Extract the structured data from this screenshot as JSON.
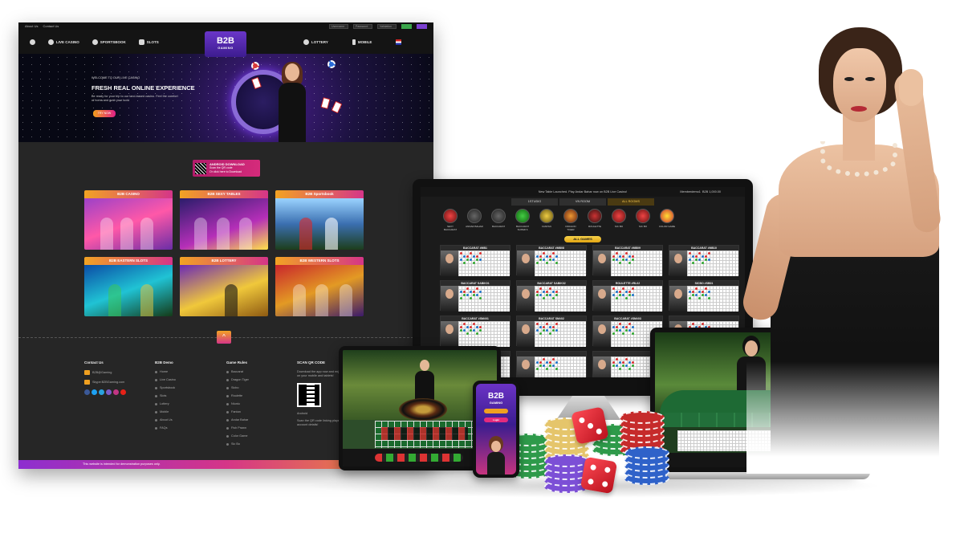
{
  "site": {
    "topstrip": {
      "about": "About Us",
      "contact": "Contact Us",
      "username_ph": "Username",
      "password_ph": "Password",
      "validation_ph": "Validation"
    },
    "nav": {
      "live_casino": "LIVE CASINO",
      "sportsbook": "SPORTSBOOK",
      "slots": "SLOTS",
      "lottery": "LOTTERY",
      "mobile": "MOBILE",
      "new_badge": "NEW"
    },
    "logo": {
      "main": "B2B",
      "sub": "GAMING"
    },
    "hero": {
      "kicker": "WELCOME TO OUR LIVE CASINO",
      "title": "FRESH REAL ONLINE EXPERIENCE",
      "desc": "Be ready for your trip to our land-based casino. Feel the comfort of home and grab your luck!",
      "cta": "TRY NOW"
    },
    "android": {
      "title": "ANDROID DOWNLOAD",
      "line1": "Scan the QR code",
      "line2": "Or click here to Download"
    },
    "tiles": [
      {
        "label": "B2B CASINO"
      },
      {
        "label": "B2B SEXY TABLES"
      },
      {
        "label": "B2B Sportsbook"
      },
      {
        "label": "B2B EASTERN SLOTS"
      },
      {
        "label": "B2B LOTTERY"
      },
      {
        "label": "B2B WESTERN SLOTS"
      }
    ],
    "footer": {
      "contact_title": "Contact Us",
      "contact_email": "B2B@Gaming",
      "contact_skype": "Skype:B2BGaming.com",
      "b2b_title": "B2B Demo",
      "b2b_links": [
        "Home",
        "Live Casino",
        "Sportsbook",
        "Slots",
        "Lottery",
        "Mobile",
        "About Us",
        "FAQs"
      ],
      "rules_title": "Game Rules",
      "rules_links": [
        "Baccarat",
        "Dragon Tiger",
        "Sicbo",
        "Roulette",
        "Niuniu",
        "Fantan",
        "Andar Bahar",
        "Fish Prawn",
        "Color Game",
        "Sic Bo"
      ],
      "qr_title": "SCAN QR CODE",
      "qr_text": "Download the app now and enjoy your Casino across on your mobile and tablets!",
      "qr_text2": "Scan the QR code linking players with their existing account details!",
      "android": "Android",
      "bar": "This website is intended for demonstration purposes only."
    }
  },
  "monitor": {
    "marquee": "New Table Launched. Play Andar Bahar now on B2B Live Casino!",
    "member": "Memberdemo1",
    "balance": "B2B 1,000.00",
    "tabs": [
      "1STUDIO",
      "VN ROOM",
      "ALL ROOMS"
    ],
    "games": [
      "SEXY BACCARAT",
      "ANDAR BAHAR",
      "BACCARAT",
      "BACCARAT SUPER 6",
      "FANTAN",
      "DRAGON TIGER",
      "ROULETTE",
      "SIC BO",
      "SIC BO",
      "COLOR GAME"
    ],
    "all_games": "ALL GAMES",
    "tables": [
      "BACCARAT #MB1",
      "BACCARAT #MB08",
      "BACCARAT #MB09",
      "BACCARAT #MB10",
      "BACCARAT SABIK01",
      "BACCARAT SABIK02",
      "ROULETTE #RL02",
      "SICBO #SB01",
      "BACCARAT #SM#01",
      "BACCARAT SM#02",
      "BACCARAT #SM#03",
      "",
      "",
      "",
      "",
      ""
    ]
  },
  "phone": {
    "logo_main": "B2B",
    "logo_sub": "GAMING",
    "btn1": "",
    "btn2": "Login"
  },
  "colors": {
    "accent_orange": "#f2a323",
    "accent_pink": "#d53588",
    "accent_purple": "#6a36c9",
    "gold": "#f6c84e"
  }
}
